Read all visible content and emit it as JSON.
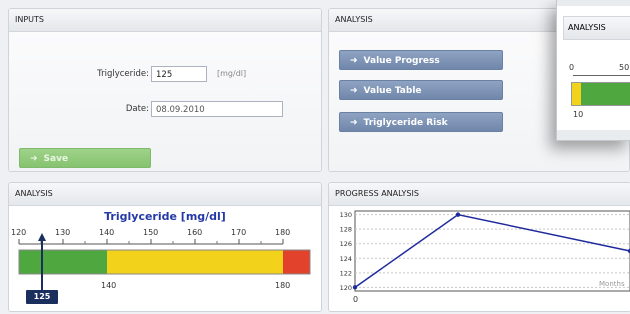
{
  "inputs": {
    "title": "INPUTS",
    "triglyceride_label": "Triglyceride:",
    "triglyceride_value": "125",
    "unit": "[mg/dl]",
    "date_label": "Date:",
    "date_value": "08.09.2010",
    "save_label": "Save"
  },
  "analysis_menu": {
    "title": "ANALYSIS",
    "buttons": [
      "Value Progress",
      "Value Table",
      "Triglyceride Risk"
    ]
  },
  "floating_window": {
    "title": "ANALYSIS",
    "ticks": [
      "0",
      "50"
    ],
    "marker": "10"
  },
  "gauge": {
    "title": "ANALYSIS",
    "heading": "Triglyceride [mg/dl]",
    "scale": [
      "120",
      "130",
      "140",
      "150",
      "160",
      "170",
      "180"
    ],
    "below_labels": [
      "140",
      "180"
    ],
    "value": "125",
    "colors": {
      "green": "#4ea73f",
      "yellow": "#f3d21c",
      "red": "#e2412b",
      "marker": "#1b2f5e"
    }
  },
  "progress": {
    "title": "PROGRESS ANALYSIS",
    "x_axis_label": "Months",
    "x_tick": "0",
    "chart_data": {
      "type": "line",
      "y_ticks": [
        120,
        122,
        124,
        126,
        128,
        130
      ],
      "ylim": [
        119.5,
        130.5
      ],
      "x": [
        0,
        1,
        2
      ],
      "values": [
        120,
        130,
        125
      ],
      "color": "#1f2a9c"
    }
  }
}
